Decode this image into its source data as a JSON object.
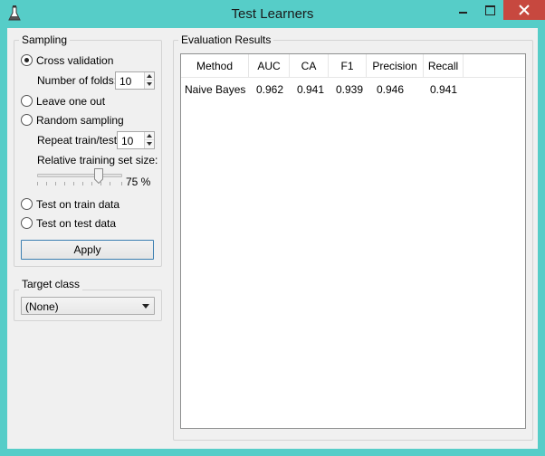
{
  "window": {
    "title": "Test Learners"
  },
  "sampling": {
    "group_title": "Sampling",
    "cross_validation_label": "Cross validation",
    "number_of_folds_label": "Number of folds:",
    "number_of_folds_value": "10",
    "leave_one_out_label": "Leave one out",
    "random_sampling_label": "Random sampling",
    "repeat_label": "Repeat train/test",
    "repeat_value": "10",
    "relative_size_label": "Relative training set size:",
    "relative_size_value": "75 %",
    "relative_size_fraction": 0.75,
    "test_on_train_label": "Test on train data",
    "test_on_test_label": "Test on test data",
    "selected": "cross_validation",
    "apply_label": "Apply"
  },
  "target": {
    "group_title": "Target class",
    "selected_value": "(None)"
  },
  "results": {
    "group_title": "Evaluation Results",
    "columns": [
      "Method",
      "AUC",
      "CA",
      "F1",
      "Precision",
      "Recall"
    ],
    "rows": [
      [
        "Naive Bayes",
        "0.962",
        "0.941",
        "0.939",
        "0.946",
        "0.941"
      ]
    ]
  }
}
